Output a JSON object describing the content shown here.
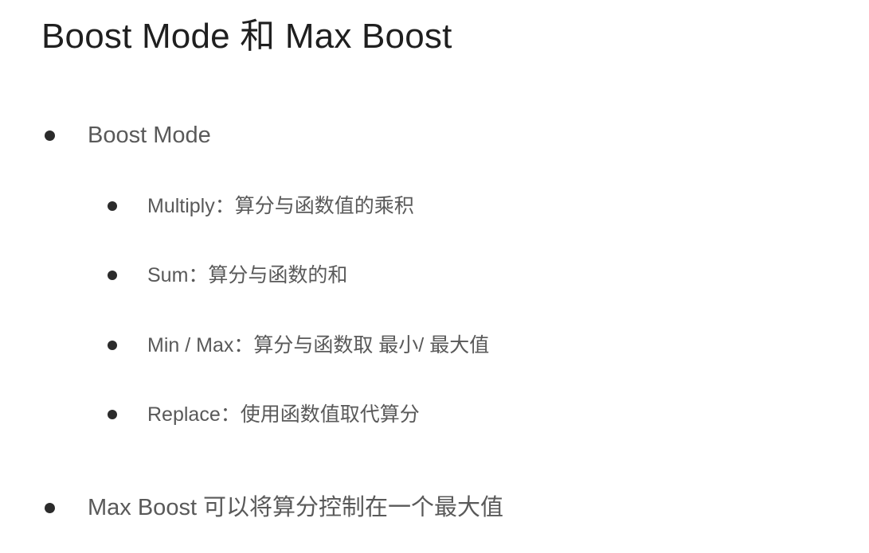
{
  "slide": {
    "title": "Boost Mode 和 Max Boost",
    "bullets": [
      {
        "text": "Boost Mode",
        "sub_bullets": [
          "Multiply：算分与函数值的乘积",
          "Sum：算分与函数的和",
          "Min / Max：算分与函数取 最小/ 最大值",
          "Replace：使用函数值取代算分"
        ]
      },
      {
        "text": "Max Boost 可以将算分控制在一个最大值"
      }
    ]
  },
  "colors": {
    "title": "#1f1f1f",
    "body_text": "#595959",
    "bullet_dot": "#2b2b2b",
    "background": "#ffffff"
  }
}
